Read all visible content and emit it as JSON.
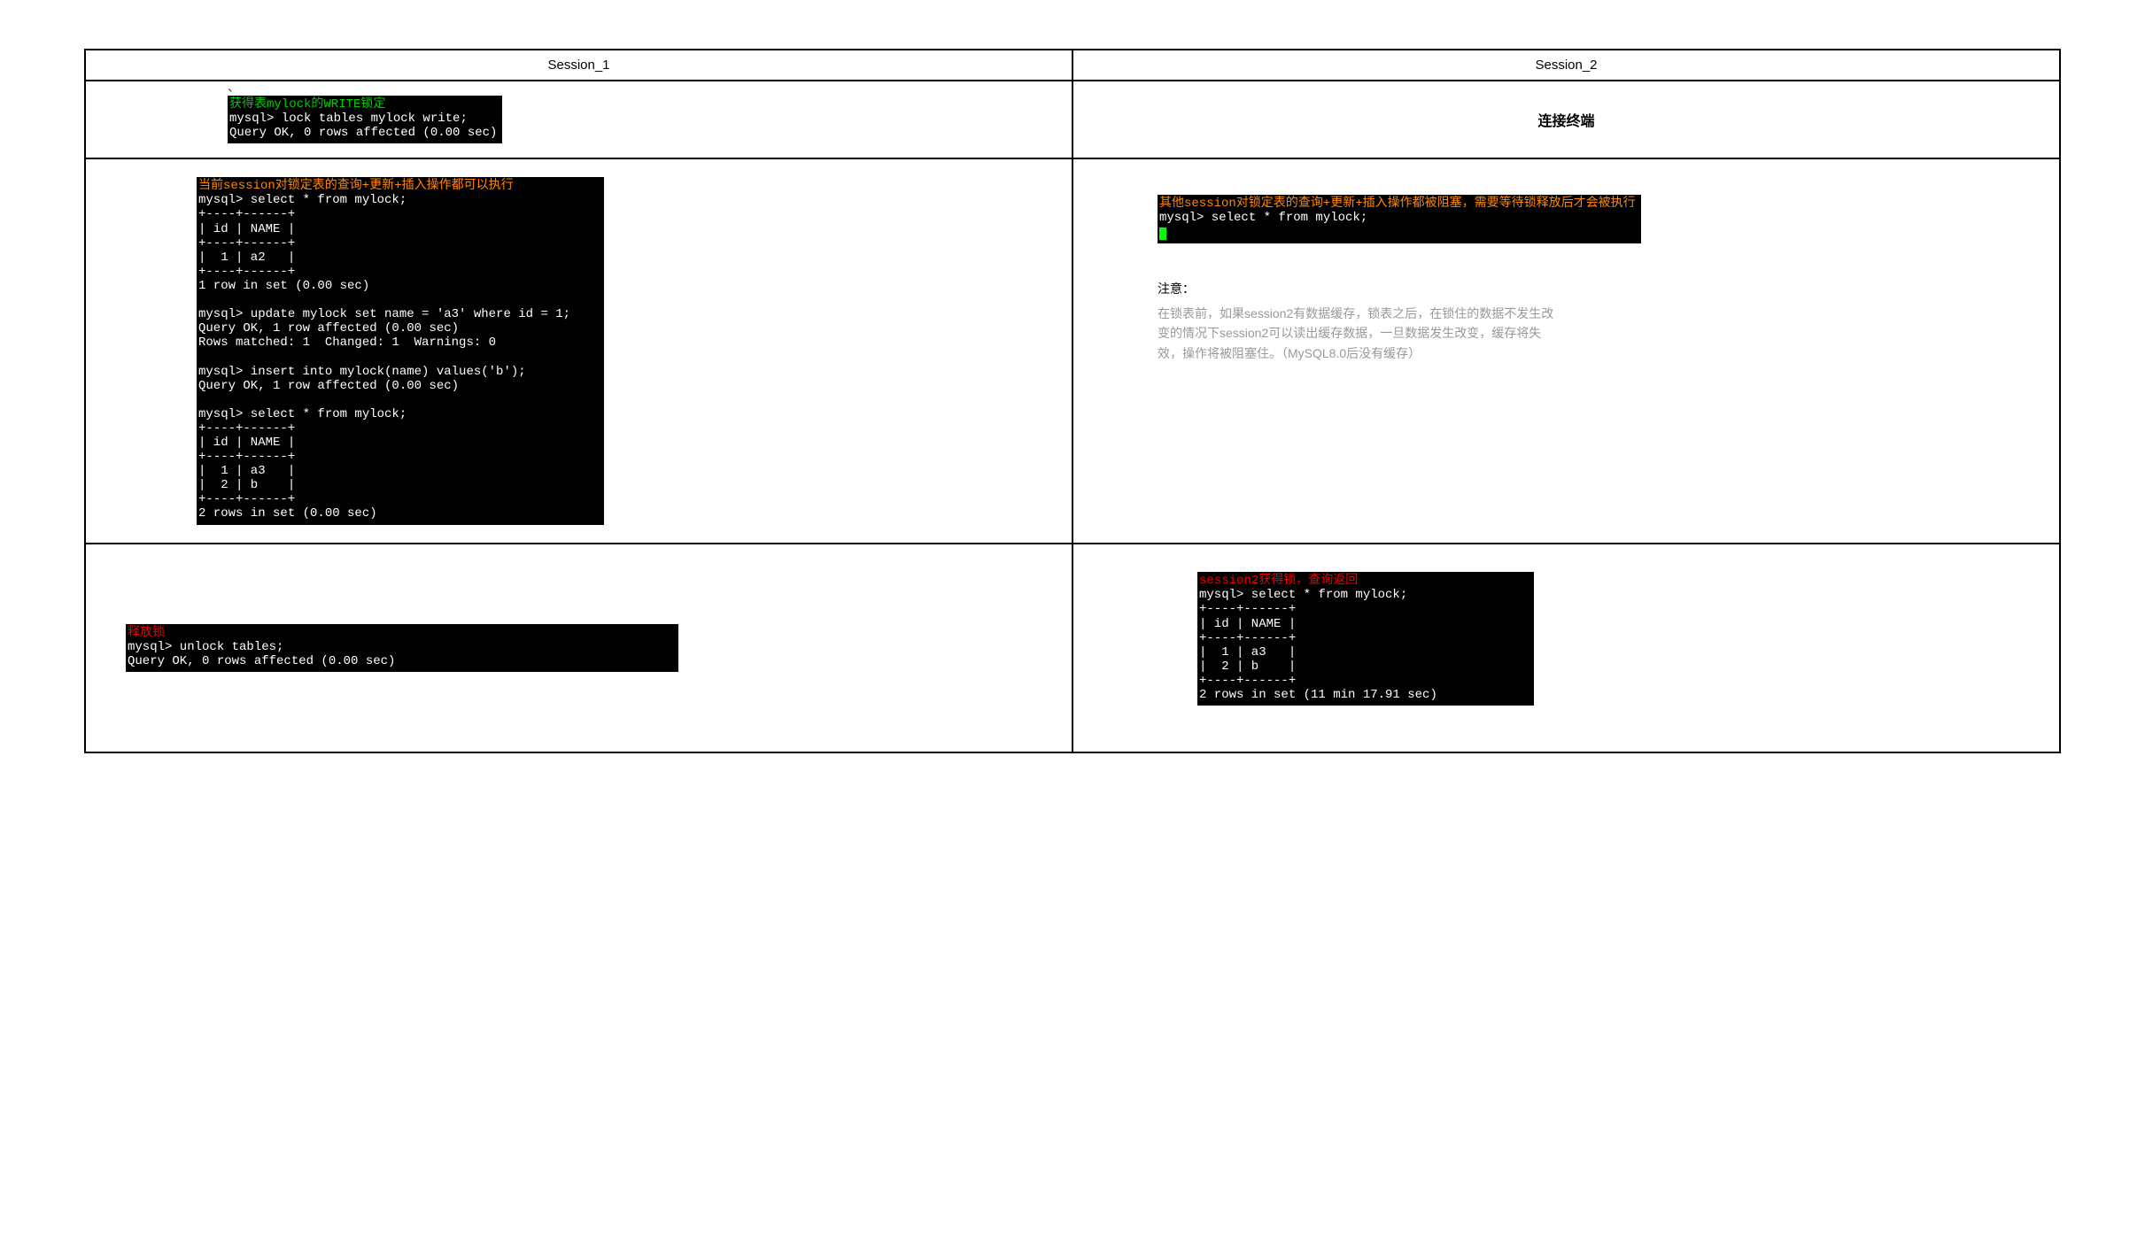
{
  "headers": {
    "col1": "Session_1",
    "col2": "Session_2"
  },
  "row1": {
    "left": {
      "title": "获得表mylock的WRITE锁定",
      "line1": "mysql> lock tables mylock write;",
      "line2": "Query OK, 0 rows affected (0.00 sec)"
    },
    "right": {
      "text": "连接终端"
    }
  },
  "row2": {
    "left": {
      "title": "当前session对锁定表的查询+更新+插入操作都可以执行",
      "body": "mysql> select * from mylock;\n+----+------+\n| id | NAME |\n+----+------+\n|  1 | a2   |\n+----+------+\n1 row in set (0.00 sec)\n\nmysql> update mylock set name = 'a3' where id = 1;\nQuery OK, 1 row affected (0.00 sec)\nRows matched: 1  Changed: 1  Warnings: 0\n\nmysql> insert into mylock(name) values('b');\nQuery OK, 1 row affected (0.00 sec)\n\nmysql> select * from mylock;\n+----+------+\n| id | NAME |\n+----+------+\n|  1 | a3   |\n|  2 | b    |\n+----+------+\n2 rows in set (0.00 sec)"
    },
    "right": {
      "title": "其他session对锁定表的查询+更新+插入操作都被阻塞，需要等待锁释放后才会被执行",
      "line1": "mysql> select * from mylock;",
      "note_label": "注意：",
      "note_text": "在锁表前，如果session2有数据缓存，锁表之后，在锁住的数据不发生改变的情况下session2可以读出缓存数据，一旦数据发生改变，缓存将失效，操作将被阻塞住。（MySQL8.0后没有缓存）"
    }
  },
  "row3": {
    "left": {
      "title": "释放锁",
      "line1": "mysql> unlock tables;",
      "line2": "Query OK, 0 rows affected (0.00 sec)"
    },
    "right": {
      "title": "session2获得锁，查询返回",
      "body": "mysql> select * from mylock;\n+----+------+\n| id | NAME |\n+----+------+\n|  1 | a3   |\n|  2 | b    |\n+----+------+\n2 rows in set (11 min 17.91 sec)"
    }
  },
  "mark": "、"
}
